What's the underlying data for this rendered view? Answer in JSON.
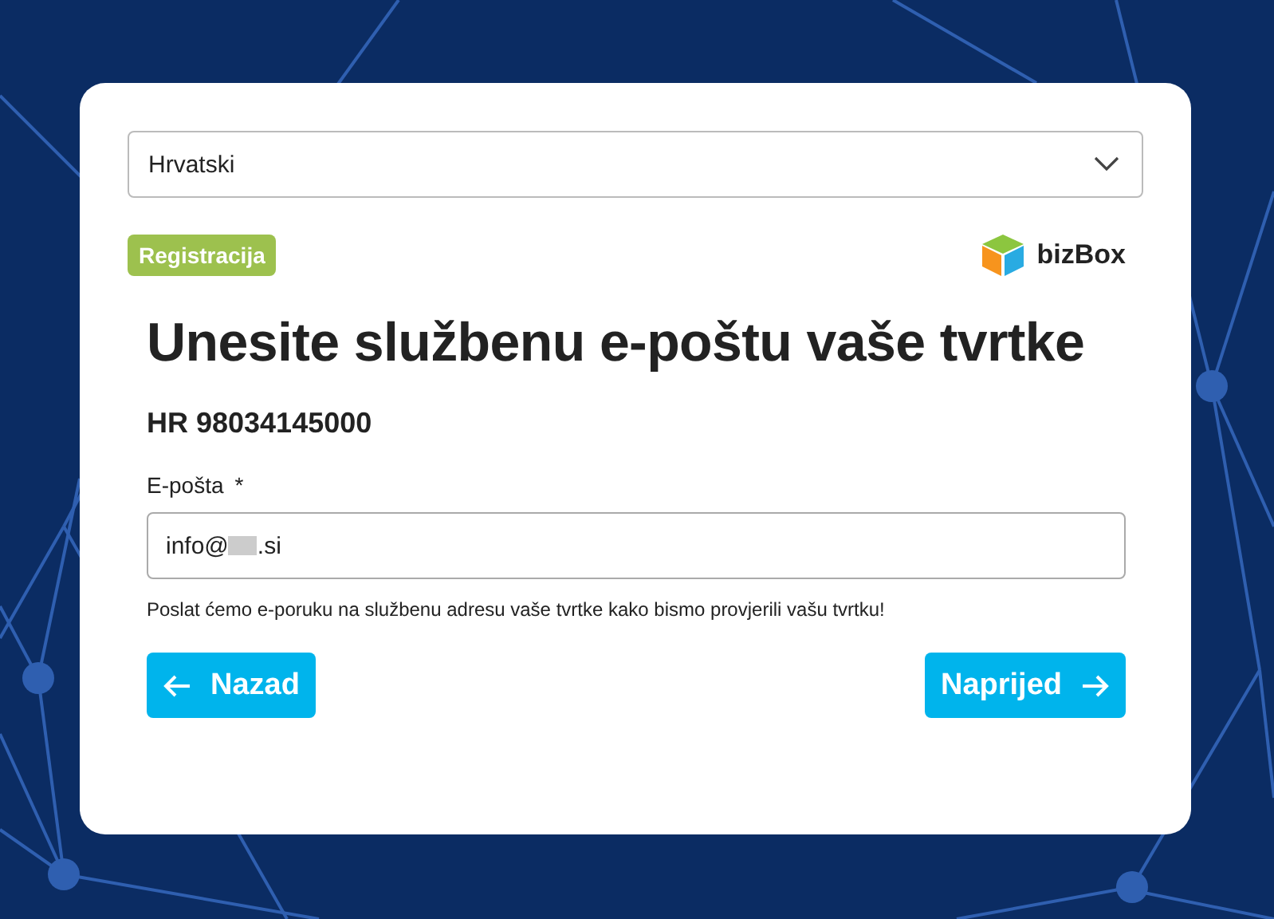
{
  "language_select": {
    "value": "Hrvatski"
  },
  "badge": "Registracija",
  "logo": {
    "text": "bizBox"
  },
  "heading": "Unesite službenu e-poštu vaše tvrtke",
  "company_id": "HR 98034145000",
  "email_field": {
    "label": "E-pošta",
    "required_mark": "*",
    "value_prefix": "info@",
    "value_suffix": ".si",
    "redacted": true
  },
  "hint": "Poslat ćemo e-poruku na službenu adresu vaše tvrtke kako bismo provjerili vašu tvrtku!",
  "buttons": [
    {
      "kind": "back",
      "label": "Nazad"
    },
    {
      "kind": "next",
      "label": "Naprijed"
    }
  ]
}
